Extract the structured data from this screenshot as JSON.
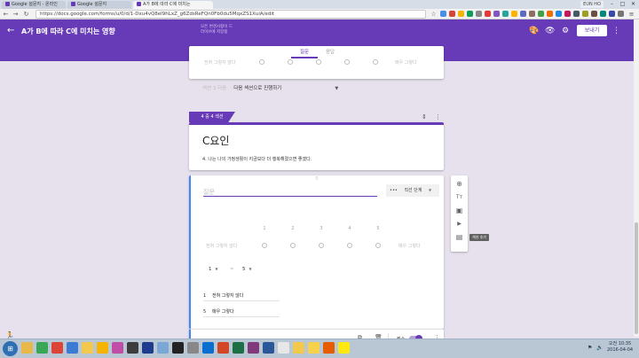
{
  "browser": {
    "tabs": [
      {
        "label": "Google 설문지 - 온라인",
        "color": "#673ab7"
      },
      {
        "label": "Google 설문지",
        "color": "#673ab7"
      },
      {
        "label": "A가 B에 따라 C에 미치는",
        "color": "#673ab7"
      }
    ],
    "user_chip": "EUN HO",
    "win_min": "–",
    "win_max": "□",
    "win_close": "✕",
    "url": "https://docs.google.com/forms/u/0/d/1-Dxu4vQ8eI9hLxZ_g6ZdsReFQn0Fb0du5MqxZS1XuiA/edit",
    "icons": {
      "back": "←",
      "forward": "→",
      "reload": "↻",
      "star": "☆"
    }
  },
  "form": {
    "title": "A가 B에 따라 C에 미치는 영향",
    "subtitle": "모든 변경사항이 드라이브에 저장됨",
    "send_label": "보내기",
    "header_icons": {
      "palette": "🎨",
      "preview": "👁",
      "settings": "⚙",
      "more": "⋮",
      "back": "←"
    },
    "tabs": {
      "questions": "질문",
      "responses": "응답"
    }
  },
  "prev_section": {
    "low_label": "전혀 그렇지 않다",
    "high_label": "매우 그렇다",
    "nav_label": "섹션 3 다음",
    "nav_value": "다음 섹션으로 진행하기",
    "caret": "▼"
  },
  "section": {
    "badge": "4 중 4 섹션",
    "title": "C요인",
    "description": "4. 나는 나의 가정생활이 지금보다 더 행복해졌으면 좋겠다.",
    "collapse_icon": "⇕",
    "more_icon": "⋮"
  },
  "question": {
    "placeholder": "질문",
    "type": "직선 단계",
    "type_icon": "•••",
    "type_caret": "▼",
    "drag_handle": "⠿",
    "scale": [
      "1",
      "2",
      "3",
      "4",
      "5"
    ],
    "low_label": "전혀 그렇지 않다",
    "high_label": "매우 그렇다",
    "min_value": "1",
    "max_value": "5",
    "dash": "~",
    "caret": "▼",
    "label_rows": [
      {
        "n": "1",
        "text": "전혀 그렇지 않다"
      },
      {
        "n": "5",
        "text": "매우 그렇다"
      }
    ],
    "copy_icon": "⧉",
    "delete_icon": "🗑",
    "required_label": "필수",
    "more_icon": "⋮"
  },
  "side_tools": {
    "add_question": "⊕",
    "add_title": "Tт",
    "add_image": "▣",
    "add_video": "▶",
    "add_section": "▤",
    "tooltip": "섹션 추가"
  },
  "taskbar": {
    "start": "⊞",
    "time": "오전 10:35",
    "date": "2016-04-04",
    "tray_icons": {
      "flag": "⚑",
      "volume": "🔊"
    },
    "apps": [
      {
        "name": "explorer",
        "color": "#e8b84a"
      },
      {
        "name": "drive",
        "color": "#3aa757"
      },
      {
        "name": "chrome",
        "color": "#db4437"
      },
      {
        "name": "ie",
        "color": "#3b7bd4"
      },
      {
        "name": "photos",
        "color": "#f2c94c"
      },
      {
        "name": "smile",
        "color": "#f4b400"
      },
      {
        "name": "paint",
        "color": "#c04da6"
      },
      {
        "name": "music",
        "color": "#3d3d3d"
      },
      {
        "name": "monitor",
        "color": "#1e3d8f"
      },
      {
        "name": "people",
        "color": "#7ba7d7"
      },
      {
        "name": "camera",
        "color": "#222222"
      },
      {
        "name": "gear",
        "color": "#888888"
      },
      {
        "name": "outlook",
        "color": "#0a6ed1"
      },
      {
        "name": "powerpoint",
        "color": "#d24726"
      },
      {
        "name": "excel",
        "color": "#1d7044"
      },
      {
        "name": "onenote",
        "color": "#80397b"
      },
      {
        "name": "word",
        "color": "#2b579a"
      },
      {
        "name": "notes",
        "color": "#e7e7e7"
      },
      {
        "name": "star",
        "color": "#f2c94c"
      },
      {
        "name": "note",
        "color": "#f7d14a"
      },
      {
        "name": "cart",
        "color": "#e65c00"
      },
      {
        "name": "talk",
        "color": "#ffe812"
      }
    ]
  },
  "bottom_left_icon": "🏃"
}
